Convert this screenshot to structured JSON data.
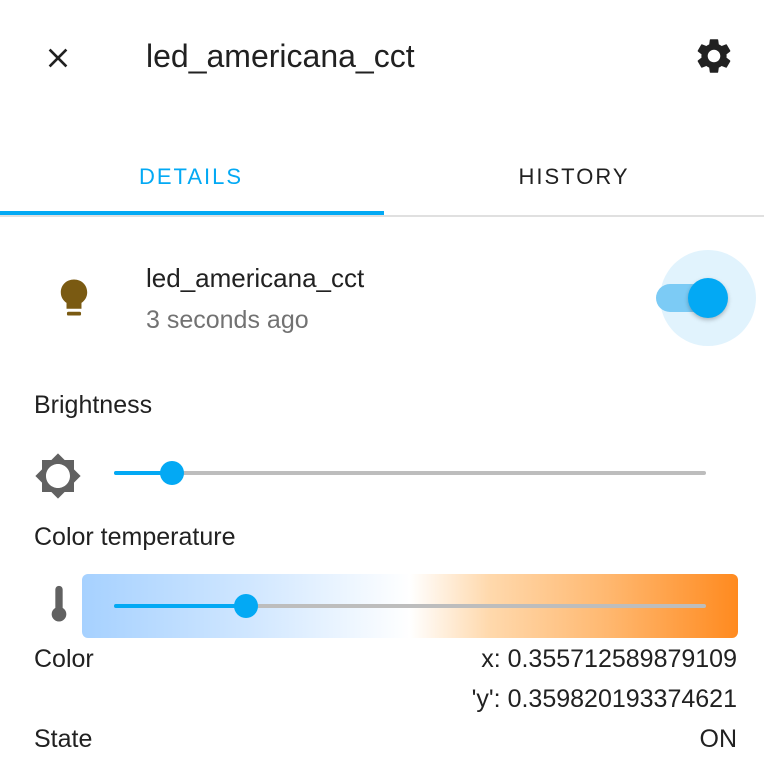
{
  "header": {
    "title": "led_americana_cct",
    "close_icon": "close-icon",
    "settings_icon": "gear-icon"
  },
  "tabs": [
    {
      "label": "DETAILS",
      "active": true
    },
    {
      "label": "HISTORY",
      "active": false
    }
  ],
  "entity": {
    "name": "led_americana_cct",
    "last_changed": "3 seconds ago",
    "icon": "lightbulb-icon",
    "icon_color": "#7a5a12",
    "toggle_on": true
  },
  "brightness": {
    "label": "Brightness",
    "icon": "brightness-icon",
    "value_fraction": 0.06
  },
  "color_temperature": {
    "label": "Color temperature",
    "icon": "thermometer-icon",
    "value_fraction": 0.19
  },
  "attributes": {
    "color_label": "Color",
    "color_x": "x: 0.355712589879109",
    "color_y": "'y': 0.359820193374621",
    "state_label": "State",
    "state_value": "ON"
  },
  "colors": {
    "accent": "#03a9f4",
    "secondary_text": "#727272",
    "primary_text": "#212121"
  }
}
